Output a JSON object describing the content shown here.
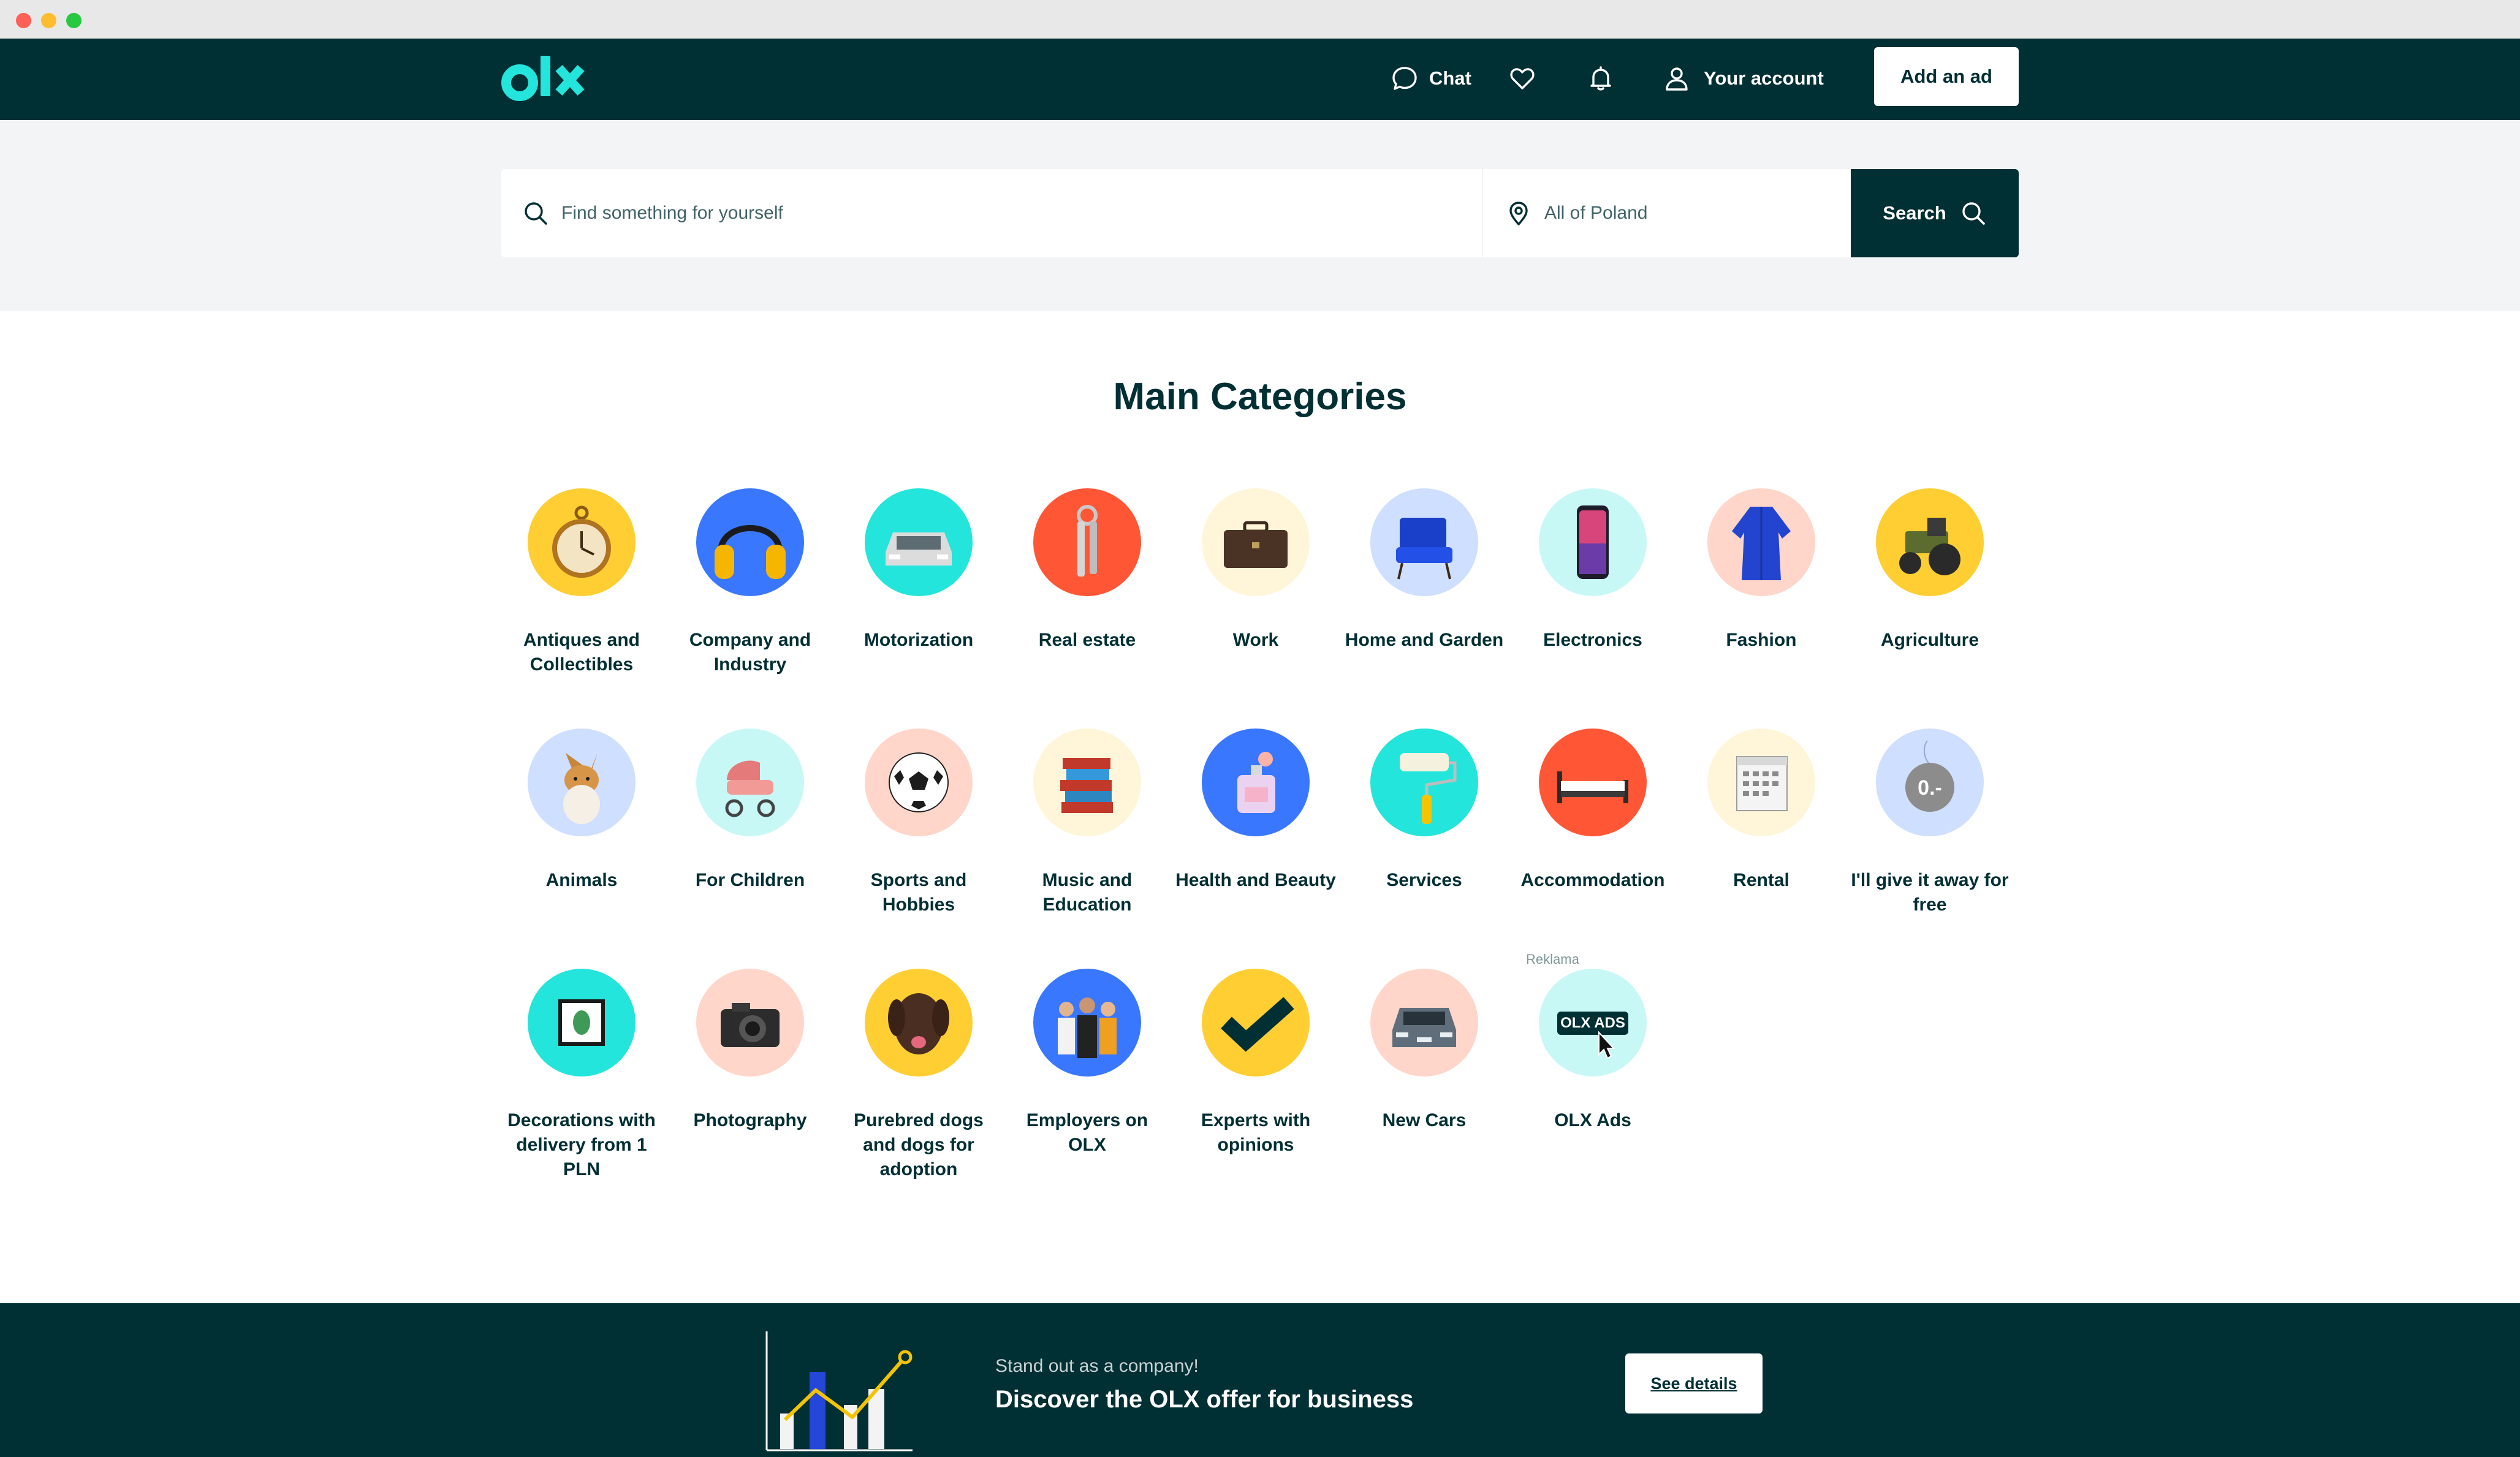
{
  "header": {
    "logo_text": "olx",
    "chat_label": "Chat",
    "account_label": "Your account",
    "add_ad_label": "Add an ad"
  },
  "search": {
    "query_placeholder": "Find something for yourself",
    "location_placeholder": "All of Poland",
    "button_label": "Search"
  },
  "categories": {
    "title": "Main Categories",
    "ad_marker": "Reklama",
    "items": [
      {
        "label": "Antiques and Collectibles",
        "icon": "pocket-watch-icon",
        "bg": "#ffce32"
      },
      {
        "label": "Company and Industry",
        "icon": "ear-defenders-icon",
        "bg": "#3a77ff"
      },
      {
        "label": "Motorization",
        "icon": "car-icon",
        "bg": "#23e5db"
      },
      {
        "label": "Real estate",
        "icon": "keys-icon",
        "bg": "#ff5636"
      },
      {
        "label": "Work",
        "icon": "briefcase-icon",
        "bg": "#fff6d9"
      },
      {
        "label": "Home and Garden",
        "icon": "armchair-icon",
        "bg": "#cedfff"
      },
      {
        "label": "Electronics",
        "icon": "smartphone-icon",
        "bg": "#c8f8f6"
      },
      {
        "label": "Fashion",
        "icon": "robe-icon",
        "bg": "#ffd6c9"
      },
      {
        "label": "Agriculture",
        "icon": "tractor-icon",
        "bg": "#ffce32"
      },
      {
        "label": "Animals",
        "icon": "corgi-icon",
        "bg": "#cedfff"
      },
      {
        "label": "For Children",
        "icon": "stroller-icon",
        "bg": "#c8f8f6"
      },
      {
        "label": "Sports and Hobbies",
        "icon": "football-icon",
        "bg": "#ffd6c9"
      },
      {
        "label": "Music and Education",
        "icon": "books-icon",
        "bg": "#fff6d9"
      },
      {
        "label": "Health and Beauty",
        "icon": "perfume-icon",
        "bg": "#3a77ff"
      },
      {
        "label": "Services",
        "icon": "paint-roller-icon",
        "bg": "#23e5db"
      },
      {
        "label": "Accommodation",
        "icon": "bed-icon",
        "bg": "#ff5636"
      },
      {
        "label": "Rental",
        "icon": "calendar-icon",
        "bg": "#fff6d9"
      },
      {
        "label": "I'll give it away for free",
        "icon": "free-tag-icon",
        "bg": "#cedfff",
        "tag_text": "0.-"
      },
      {
        "label": "Decorations with delivery from 1 PLN",
        "icon": "framed-leaf-icon",
        "bg": "#23e5db"
      },
      {
        "label": "Photography",
        "icon": "camera-icon",
        "bg": "#ffd6c9"
      },
      {
        "label": "Purebred dogs and dogs for adoption",
        "icon": "labrador-icon",
        "bg": "#ffce32"
      },
      {
        "label": "Employers on OLX",
        "icon": "employees-icon",
        "bg": "#3a77ff"
      },
      {
        "label": "Experts with opinions",
        "icon": "checkmark-icon",
        "bg": "#ffce32"
      },
      {
        "label": "New Cars",
        "icon": "suv-icon",
        "bg": "#ffd6c9"
      },
      {
        "label": "OLX Ads",
        "icon": "olx-ads-icon",
        "bg": "#c8f8f6",
        "badge_text": "OLX ADS"
      }
    ]
  },
  "promo": {
    "subtitle": "Stand out as a company!",
    "title": "Discover the OLX offer for business",
    "button_label": "See details"
  },
  "colors": {
    "brand_dark": "#002f34",
    "brand_teal": "#23e5db",
    "search_band": "#f2f4f5"
  }
}
